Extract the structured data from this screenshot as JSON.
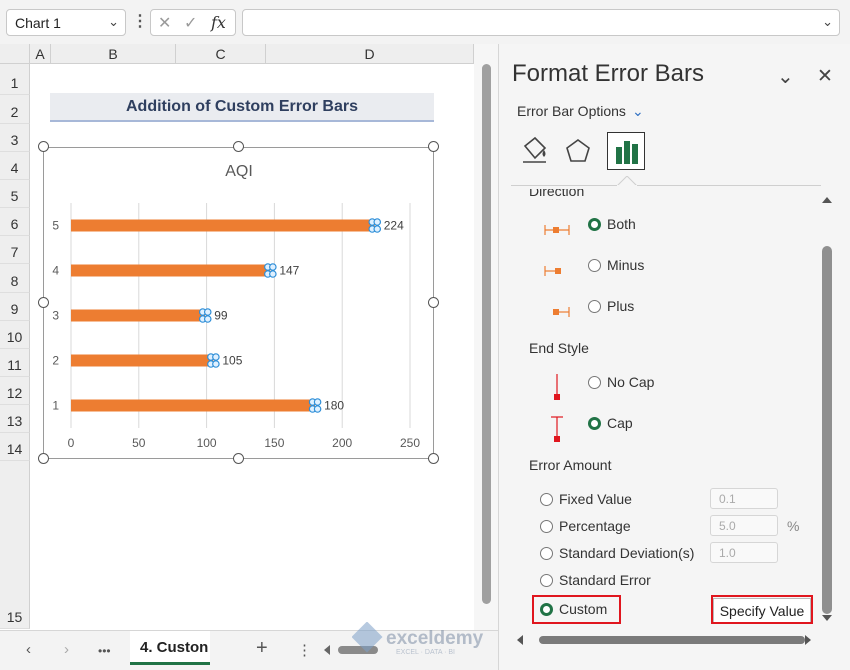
{
  "formula_bar": {
    "name_box": "Chart 1",
    "fx_label": "fx",
    "formula": ""
  },
  "grid": {
    "columns": [
      "A",
      "B",
      "C",
      "D"
    ],
    "rows": [
      "1",
      "2",
      "3",
      "4",
      "5",
      "6",
      "7",
      "8",
      "9",
      "10",
      "11",
      "12",
      "13",
      "14",
      "15"
    ],
    "title_cell": "Addition of Custom Error Bars"
  },
  "chart_data": {
    "type": "bar",
    "orientation": "horizontal",
    "title": "AQI",
    "categories": [
      "1",
      "2",
      "3",
      "4",
      "5"
    ],
    "values": [
      180,
      105,
      99,
      147,
      224
    ],
    "data_labels": [
      "180",
      "105",
      "99",
      "147",
      "224"
    ],
    "xlim": [
      0,
      250
    ],
    "xticks": [
      "0",
      "50",
      "100",
      "150",
      "200",
      "250"
    ],
    "grid": "vertical",
    "bar_color": "#ed7d31",
    "error_bars": "custom",
    "error_bar_color": "#2f8fd8"
  },
  "sheet_tabs": {
    "active": "4. Custon",
    "nav_prev": "‹",
    "nav_next": "›",
    "more": "•••",
    "add": "+",
    "options": "⋮"
  },
  "panel": {
    "title": "Format Error Bars",
    "options_dropdown": "Error Bar Options",
    "icons": [
      "fill-line-icon",
      "effects-pentagon-icon",
      "bar-chart-options-icon"
    ],
    "direction_label": "Direction",
    "direction_options": [
      {
        "label": "Both",
        "selected": true
      },
      {
        "label": "Minus",
        "selected": false
      },
      {
        "label": "Plus",
        "selected": false
      }
    ],
    "end_style_label": "End Style",
    "end_style_options": [
      {
        "label": "No Cap",
        "selected": false
      },
      {
        "label": "Cap",
        "selected": true
      }
    ],
    "error_amount_label": "Error Amount",
    "amount_options": [
      {
        "label": "Fixed Value",
        "value": "0.1",
        "selected": false
      },
      {
        "label": "Percentage",
        "value": "5.0",
        "unit": "%",
        "selected": false
      },
      {
        "label": "Standard Deviation(s)",
        "value": "1.0",
        "selected": false
      },
      {
        "label": "Standard Error",
        "selected": false
      },
      {
        "label": "Custom",
        "selected": true
      }
    ],
    "specify_value_button": "Specify Value",
    "accent_color": "#217346",
    "highlight_color": "#e0161e"
  },
  "watermark": {
    "brand": "exceldemy",
    "tagline": "EXCEL · DATA · BI"
  }
}
